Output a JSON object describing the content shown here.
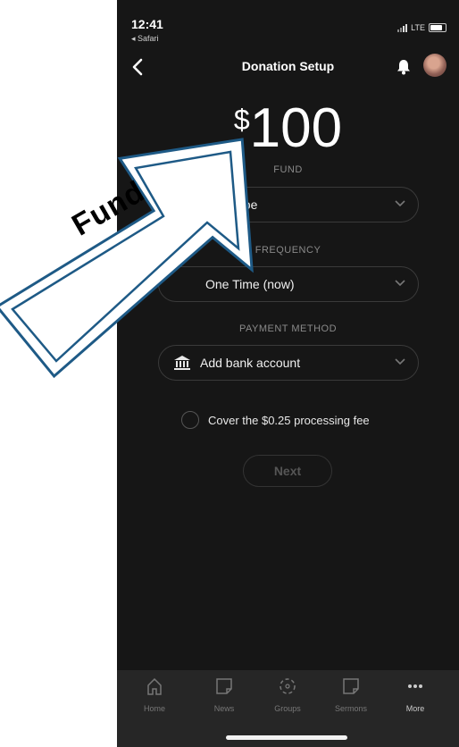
{
  "status": {
    "time": "12:41",
    "back_app": "◂ Safari",
    "network": "LTE"
  },
  "nav": {
    "title": "Donation Setup"
  },
  "amount": {
    "currency": "$",
    "value": "100"
  },
  "fund": {
    "label": "FUND",
    "value": "Envelope"
  },
  "frequency": {
    "label": "FREQUENCY",
    "value": "One Time (now)"
  },
  "payment": {
    "label": "PAYMENT METHOD",
    "value": "Add bank account"
  },
  "fee": {
    "label": "Cover the $0.25 processing fee"
  },
  "next": {
    "label": "Next"
  },
  "tabs": [
    {
      "label": "Home",
      "icon": "home-icon"
    },
    {
      "label": "News",
      "icon": "news-icon"
    },
    {
      "label": "Groups",
      "icon": "groups-icon"
    },
    {
      "label": "Sermons",
      "icon": "sermons-icon"
    },
    {
      "label": "More",
      "icon": "more-icon"
    }
  ],
  "annotation": {
    "text": "Fund"
  },
  "colors": {
    "background": "#161616",
    "tabbar": "#262626",
    "arrow_outline": "#1e5a86"
  }
}
